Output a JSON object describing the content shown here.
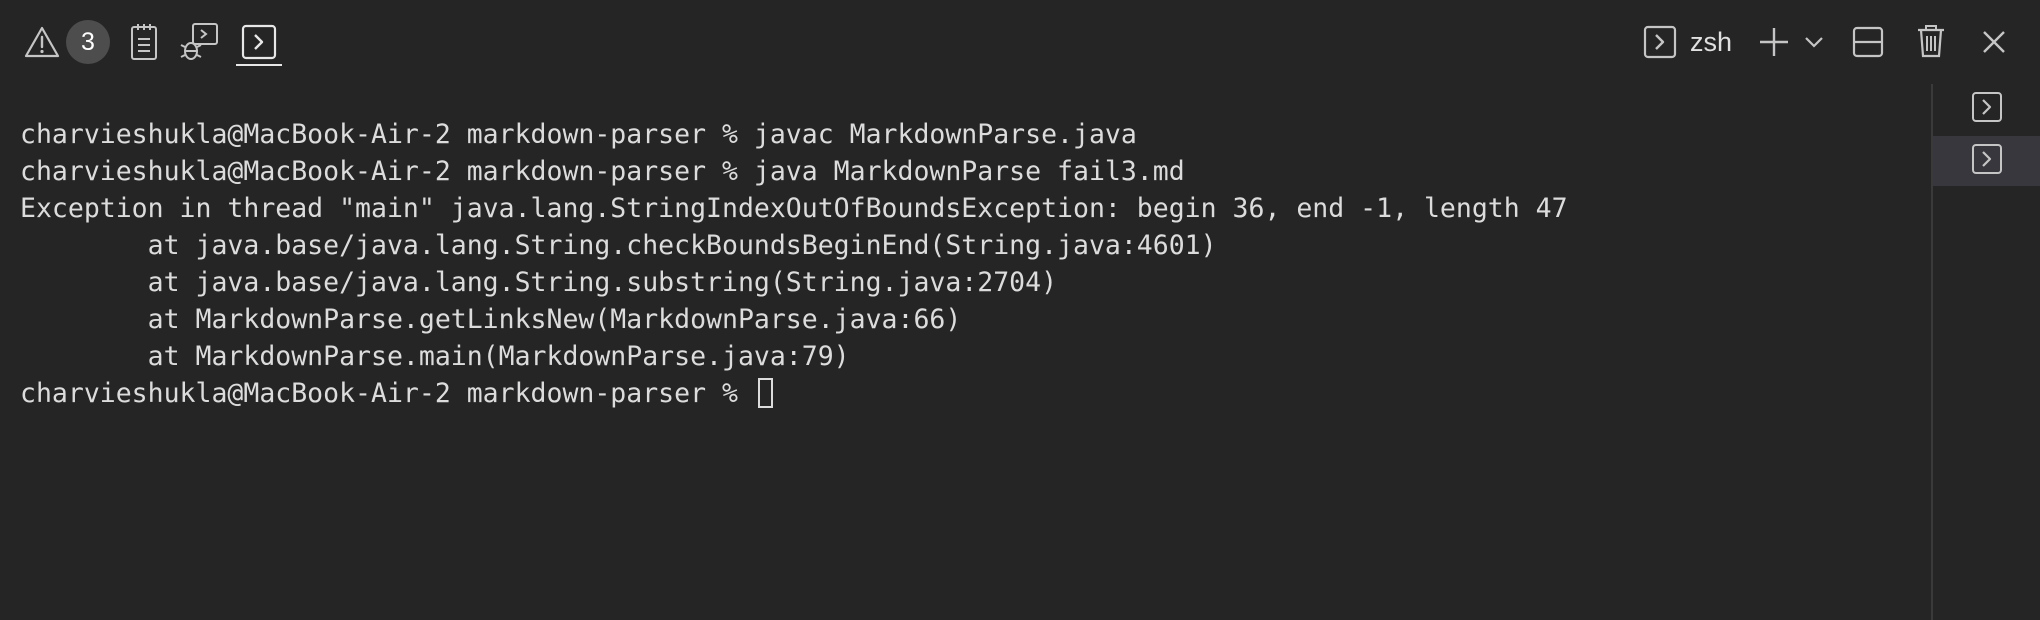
{
  "toolbar": {
    "problems_badge": "3",
    "icons": [
      "warning-icon",
      "output-icon",
      "debug-console-icon",
      "terminal-icon"
    ],
    "shell_name": "zsh",
    "actions": [
      "new-terminal-icon",
      "launch-profile-chevron-icon",
      "split-terminal-icon",
      "trash-icon",
      "close-icon"
    ]
  },
  "terminal": {
    "lines": [
      "charvieshukla@MacBook-Air-2 markdown-parser % javac MarkdownParse.java",
      "charvieshukla@MacBook-Air-2 markdown-parser % java MarkdownParse fail3.md",
      "Exception in thread \"main\" java.lang.StringIndexOutOfBoundsException: begin 36, end -1, length 47",
      "        at java.base/java.lang.String.checkBoundsBeginEnd(String.java:4601)",
      "        at java.base/java.lang.String.substring(String.java:2704)",
      "        at MarkdownParse.getLinksNew(MarkdownParse.java:66)",
      "        at MarkdownParse.main(MarkdownParse.java:79)"
    ],
    "prompt": "charvieshukla@MacBook-Air-2 markdown-parser % "
  },
  "tab_list": {
    "tabs": [
      "terminal-1",
      "terminal-2"
    ],
    "selected": 1
  },
  "colors": {
    "background": "#252526",
    "text": "#dcdcdc",
    "icon": "#c5c5c5",
    "badge": "#4d4d4d",
    "selected_tab": "#37373d"
  }
}
